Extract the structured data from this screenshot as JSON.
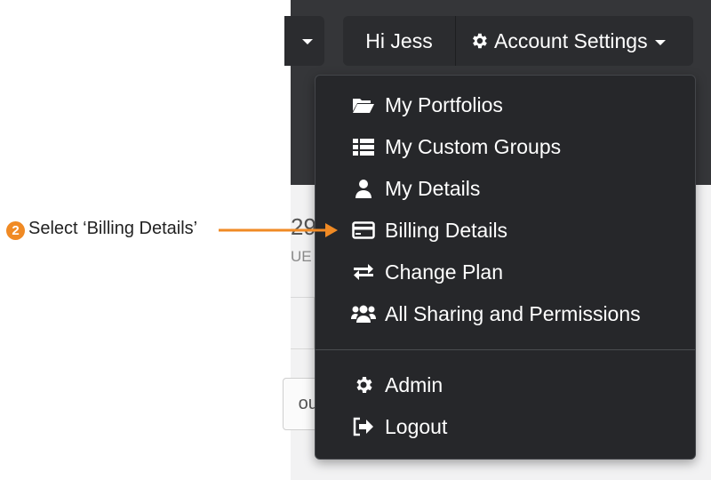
{
  "navbar": {
    "greeting": "Hi Jess",
    "account_settings_label": "Account Settings"
  },
  "background": {
    "number_fragment": "29",
    "label_fragment": "UE",
    "button_fragment": "oun"
  },
  "menu": {
    "items": [
      {
        "label": "My Portfolios",
        "icon": "folder-open-icon"
      },
      {
        "label": "My Custom Groups",
        "icon": "list-icon"
      },
      {
        "label": "My Details",
        "icon": "user-icon"
      },
      {
        "label": "Billing Details",
        "icon": "credit-card-icon"
      },
      {
        "label": "Change Plan",
        "icon": "exchange-icon"
      },
      {
        "label": "All Sharing and Permissions",
        "icon": "users-icon"
      },
      {
        "label": "Admin",
        "icon": "gear-icon"
      },
      {
        "label": "Logout",
        "icon": "sign-out-icon"
      }
    ]
  },
  "annotation": {
    "step_number": "2",
    "instruction": "Select ‘Billing Details’"
  },
  "colors": {
    "accent": "#f08a24",
    "menu_background": "#26272a",
    "navbar_background": "#353639"
  }
}
